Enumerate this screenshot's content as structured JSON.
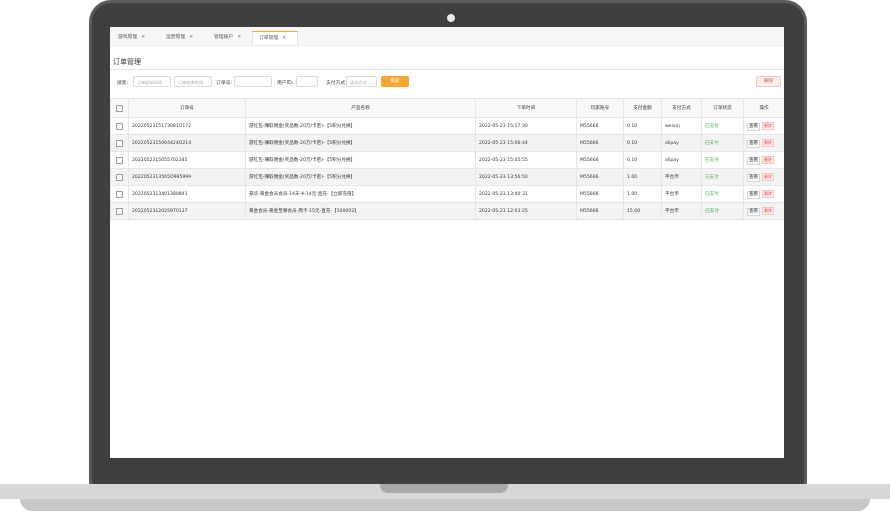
{
  "tabs": [
    {
      "label": "游戏管理",
      "close": "×"
    },
    {
      "label": "运营管理",
      "close": "×"
    },
    {
      "label": "管理账户",
      "close": "×"
    },
    {
      "label": "订单管理",
      "close": "×"
    }
  ],
  "page_title": "订单管理",
  "filters": {
    "search_label": "搜索:",
    "start_time_placeholder": "订单起始时间",
    "end_time_placeholder": "订单结束时间",
    "order_no_label": "订单号:",
    "user_id_label": "用户ID:",
    "pay_method_label": "支付方式:",
    "pay_method_value": "请选方式",
    "search_button": "搜索",
    "delete_button": "删除"
  },
  "table": {
    "columns": [
      "订单号",
      "产品名称",
      "下单时间",
      "玩家账号",
      "支付金额",
      "支付方式",
      "订单状态",
      "操作"
    ],
    "view_label": "查看",
    "delete_label": "删除",
    "rows": [
      {
        "order_no": "2022052315173081O172",
        "product": "游红包-赚取佣金(奖品数-20万/卡密)-【5积分兑换】",
        "time": "2022-05-23 15:17:30",
        "account": "M55666",
        "amount": "0.10",
        "method": "weixin",
        "status": "已支付"
      },
      {
        "order_no": "2022052315064424O214",
        "product": "游红包-赚取佣金(奖品数-20万/卡密)-【5积分兑换】",
        "time": "2022-05-23 15:06:44",
        "account": "M55666",
        "amount": "0.10",
        "method": "alipay",
        "status": "已支付"
      },
      {
        "order_no": "2022052315055702345",
        "product": "游红包-赚取佣金(奖品数-20万/卡密)-【5积分兑换】",
        "time": "2022-05-23 15:05:55",
        "account": "M55666",
        "amount": "0.10",
        "method": "alipay",
        "status": "已支付"
      },
      {
        "order_no": "2022052313565O995999",
        "product": "游红包-赚取佣金(奖品数-20万/卡密)-【5积分兑换】",
        "time": "2022-05-23 13:56:50",
        "account": "M55666",
        "amount": "1.00",
        "method": "平台币",
        "status": "已支付"
      },
      {
        "order_no": "2022052313401380841",
        "product": "豪华-黄金会员会员-14天-¥-14元-直充-【立即充值】",
        "time": "2022-05-23 13:40:31",
        "account": "M55666",
        "amount": "1.00",
        "method": "平台币",
        "status": "已支付"
      },
      {
        "order_no": "2022052312025970137",
        "product": "黄金会员-黄金至尊会员-周卡-15元-直充-【100002】",
        "time": "2022-05-23 12:03:25",
        "account": "M55666",
        "amount": "15.00",
        "method": "平台币",
        "status": "已支付"
      }
    ]
  }
}
